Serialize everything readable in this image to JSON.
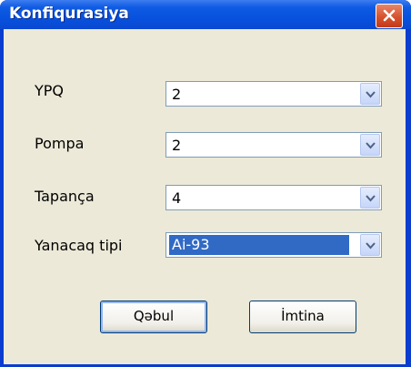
{
  "window": {
    "title": "Konfiqurasiya"
  },
  "fields": [
    {
      "label": "YPQ",
      "value": "2"
    },
    {
      "label": "Pompa",
      "value": "2"
    },
    {
      "label": "Tapança",
      "value": "4"
    },
    {
      "label": "Yanacaq tipi",
      "value": "Ai-93"
    }
  ],
  "buttons": {
    "ok_label": "Qəbul",
    "cancel_label": "İmtina"
  },
  "colors": {
    "title_bar": "#0752df",
    "close_button": "#d6522e",
    "dialog_background": "#ece9d8",
    "selection": "#316ac5"
  }
}
